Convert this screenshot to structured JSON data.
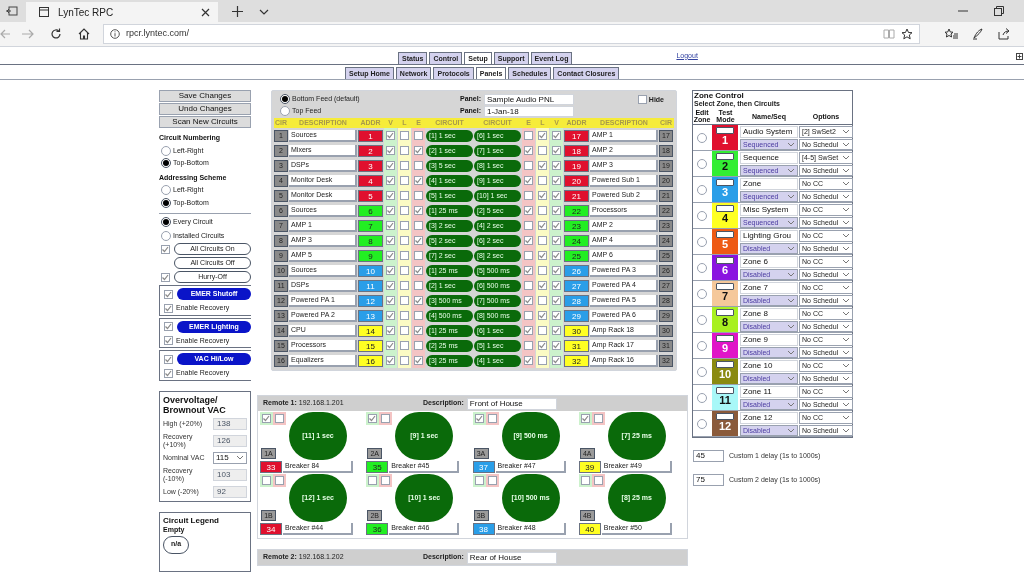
{
  "browser": {
    "tab_title": "LynTec RPC",
    "url": "rpcr.lyntec.com/"
  },
  "nav": {
    "tabs": [
      {
        "label": "Status",
        "selected": false
      },
      {
        "label": "Control",
        "selected": false
      },
      {
        "label": "Setup",
        "selected": true
      },
      {
        "label": "Support",
        "selected": false
      },
      {
        "label": "Event Log",
        "selected": false
      }
    ],
    "logout": "Logout",
    "subtabs": [
      {
        "label": "Setup Home",
        "selected": false
      },
      {
        "label": "Network",
        "selected": false
      },
      {
        "label": "Protocols",
        "selected": false
      },
      {
        "label": "Panels",
        "selected": true
      },
      {
        "label": "Schedules",
        "selected": false
      },
      {
        "label": "Contact Closures",
        "selected": false
      }
    ]
  },
  "sidebar": {
    "buttons": [
      "Save Changes",
      "Undo Changes",
      "Scan New Circuits"
    ],
    "groups": [
      {
        "title": "Circuit Numbering",
        "options": [
          {
            "label": "Left-Right",
            "selected": false
          },
          {
            "label": "Top-Bottom",
            "selected": true
          }
        ]
      },
      {
        "title": "Addressing Scheme",
        "options": [
          {
            "label": "Left-Right",
            "selected": false
          },
          {
            "label": "Top-Bottom",
            "selected": true
          }
        ]
      }
    ],
    "filter": [
      {
        "label": "Every Circuit",
        "selected": true
      },
      {
        "label": "Installed Circuits",
        "selected": false
      }
    ],
    "actions": [
      {
        "kind": "outline",
        "label": "All Circuits On",
        "checked": true
      },
      {
        "kind": "outline",
        "label": "All Circuits Off"
      },
      {
        "kind": "outline",
        "label": "Hurry-Off",
        "checked": true
      },
      {
        "kind": "emergency",
        "label": "EMER Shutoff",
        "checked": true,
        "recovery": {
          "label": "Enable Recovery",
          "checked": true
        }
      },
      {
        "kind": "emergency",
        "label": "EMER Lighting",
        "checked": true,
        "recovery": {
          "label": "Enable Recovery",
          "checked": true
        }
      },
      {
        "kind": "emergency",
        "label": "VAC Hi/Low",
        "checked": true,
        "recovery": {
          "label": "Enable Recovery",
          "checked": true
        }
      }
    ],
    "voltage": {
      "title": "Overvoltage/ Brownout VAC",
      "rows": [
        {
          "kind": "readonly",
          "label": "High (+20%)",
          "value": "138"
        },
        {
          "kind": "readonly",
          "label": "Recovery (+10%)",
          "value": "126"
        },
        {
          "kind": "select",
          "label": "Nominal VAC",
          "value": "115"
        },
        {
          "kind": "readonly",
          "label": "Recovery (-10%)",
          "value": "103"
        },
        {
          "kind": "readonly",
          "label": "Low (-20%)",
          "value": "92"
        }
      ]
    },
    "legend": {
      "title": "Circuit Legend",
      "subtitle": "Empty",
      "sample": "n/a"
    }
  },
  "panel": {
    "feeds": [
      {
        "label": "Bottom Feed (default)",
        "selected": true
      },
      {
        "label": "Top Feed",
        "selected": false
      }
    ],
    "fields": [
      {
        "label": "Panel:",
        "value": "Sample Audio PNL"
      },
      {
        "label": "Panel:",
        "value": "1-Jan-18"
      }
    ],
    "hide": {
      "label": "Hide",
      "checked": false
    },
    "columns_left": [
      "CIR",
      "DESCRIPTION",
      "ADDR",
      "V",
      "L",
      "E",
      "CIRCUIT"
    ],
    "columns_right": [
      "CIRCUIT",
      "E",
      "L",
      "V",
      "ADDR",
      "DESCRIPTION",
      "CIR"
    ],
    "rows": [
      {
        "left": {
          "cir": "1",
          "description": "Sources",
          "addr": "1",
          "color": "#e0102e",
          "v": true,
          "l": false,
          "e": false,
          "circuit": "[1] 1 sec"
        },
        "right": {
          "cir": "17",
          "description": "AMP 1",
          "addr": "17",
          "color": "#e0102e",
          "v": true,
          "l": true,
          "e": false,
          "circuit": "[6] 1 sec"
        }
      },
      {
        "left": {
          "cir": "2",
          "description": "Mixers",
          "addr": "2",
          "color": "#e0102e",
          "v": true,
          "l": false,
          "e": true,
          "circuit": "[2] 1 sec"
        },
        "right": {
          "cir": "18",
          "description": "AMP 2",
          "addr": "18",
          "color": "#e0102e",
          "v": true,
          "l": false,
          "e": true,
          "circuit": "[7] 1 sec"
        }
      },
      {
        "left": {
          "cir": "3",
          "description": "DSPs",
          "addr": "3",
          "color": "#e0102e",
          "v": true,
          "l": false,
          "e": false,
          "circuit": "[3] 5 sec"
        },
        "right": {
          "cir": "19",
          "description": "AMP 3",
          "addr": "19",
          "color": "#e0102e",
          "v": true,
          "l": true,
          "e": false,
          "circuit": "[8] 1 sec"
        }
      },
      {
        "left": {
          "cir": "4",
          "description": "Monitor Desk",
          "addr": "4",
          "color": "#e0102e",
          "v": true,
          "l": false,
          "e": true,
          "circuit": "[4] 1 sec"
        },
        "right": {
          "cir": "20",
          "description": "Powered Sub 1",
          "addr": "20",
          "color": "#e0102e",
          "v": true,
          "l": false,
          "e": true,
          "circuit": "[9] 1 sec"
        }
      },
      {
        "left": {
          "cir": "5",
          "description": "Monitor Desk",
          "addr": "5",
          "color": "#e0102e",
          "v": true,
          "l": false,
          "e": false,
          "circuit": "[5] 1 sec"
        },
        "right": {
          "cir": "21",
          "description": "Powered Sub 2",
          "addr": "21",
          "color": "#e0102e",
          "v": true,
          "l": true,
          "e": false,
          "circuit": "[10] 1 sec"
        }
      },
      {
        "left": {
          "cir": "6",
          "description": "Sources",
          "addr": "6",
          "color": "#22ee22",
          "v": true,
          "l": false,
          "e": true,
          "circuit": "[1] 25 ms"
        },
        "right": {
          "cir": "22",
          "description": "Processors",
          "addr": "22",
          "color": "#22ee22",
          "v": true,
          "l": false,
          "e": true,
          "circuit": "[2] 5 sec"
        }
      },
      {
        "left": {
          "cir": "7",
          "description": "AMP 1",
          "addr": "7",
          "color": "#22ee22",
          "v": true,
          "l": false,
          "e": false,
          "circuit": "[3] 2 sec"
        },
        "right": {
          "cir": "23",
          "description": "AMP 2",
          "addr": "23",
          "color": "#22ee22",
          "v": true,
          "l": true,
          "e": false,
          "circuit": "[4] 2 sec"
        }
      },
      {
        "left": {
          "cir": "8",
          "description": "AMP 3",
          "addr": "8",
          "color": "#22ee22",
          "v": true,
          "l": false,
          "e": true,
          "circuit": "[5] 2 sec"
        },
        "right": {
          "cir": "24",
          "description": "AMP 4",
          "addr": "24",
          "color": "#22ee22",
          "v": true,
          "l": false,
          "e": true,
          "circuit": "[6] 2 sec"
        }
      },
      {
        "left": {
          "cir": "9",
          "description": "AMP 5",
          "addr": "9",
          "color": "#22ee22",
          "v": true,
          "l": false,
          "e": false,
          "circuit": "[7] 2 sec"
        },
        "right": {
          "cir": "25",
          "description": "AMP 6",
          "addr": "25",
          "color": "#22ee22",
          "v": true,
          "l": true,
          "e": false,
          "circuit": "[8] 2 sec"
        }
      },
      {
        "left": {
          "cir": "10",
          "description": "Sources",
          "addr": "10",
          "color": "#2a9ee8",
          "v": true,
          "l": false,
          "e": true,
          "circuit": "[1] 25 ms"
        },
        "right": {
          "cir": "26",
          "description": "Powered PA 3",
          "addr": "26",
          "color": "#2a9ee8",
          "v": true,
          "l": false,
          "e": true,
          "circuit": "[5] 500 ms"
        }
      },
      {
        "left": {
          "cir": "11",
          "description": "DSPs",
          "addr": "11",
          "color": "#2a9ee8",
          "v": true,
          "l": false,
          "e": false,
          "circuit": "[2] 1 sec"
        },
        "right": {
          "cir": "27",
          "description": "Powered PA 4",
          "addr": "27",
          "color": "#2a9ee8",
          "v": true,
          "l": true,
          "e": false,
          "circuit": "[6] 500 ms"
        }
      },
      {
        "left": {
          "cir": "12",
          "description": "Powered PA 1",
          "addr": "12",
          "color": "#2a9ee8",
          "v": true,
          "l": false,
          "e": true,
          "circuit": "[3] 500 ms"
        },
        "right": {
          "cir": "28",
          "description": "Powered PA 5",
          "addr": "28",
          "color": "#2a9ee8",
          "v": true,
          "l": false,
          "e": true,
          "circuit": "[7] 500 ms"
        }
      },
      {
        "left": {
          "cir": "13",
          "description": "Powered PA 2",
          "addr": "13",
          "color": "#2a9ee8",
          "v": true,
          "l": false,
          "e": false,
          "circuit": "[4] 500 ms"
        },
        "right": {
          "cir": "29",
          "description": "Powered PA 6",
          "addr": "29",
          "color": "#2a9ee8",
          "v": true,
          "l": true,
          "e": false,
          "circuit": "[8] 500 ms"
        }
      },
      {
        "left": {
          "cir": "14",
          "description": "CPU",
          "addr": "14",
          "color": "#ffff22",
          "v": true,
          "l": false,
          "e": true,
          "circuit": "[1] 25 ms"
        },
        "right": {
          "cir": "30",
          "description": "Amp Rack 18",
          "addr": "30",
          "color": "#ffff22",
          "v": true,
          "l": false,
          "e": true,
          "circuit": "[6] 1 sec"
        }
      },
      {
        "left": {
          "cir": "15",
          "description": "Processors",
          "addr": "15",
          "color": "#ffff22",
          "v": true,
          "l": false,
          "e": false,
          "circuit": "[2] 25 ms"
        },
        "right": {
          "cir": "31",
          "description": "Amp Rack 17",
          "addr": "31",
          "color": "#ffff22",
          "v": true,
          "l": true,
          "e": false,
          "circuit": "[5] 1 sec"
        }
      },
      {
        "left": {
          "cir": "16",
          "description": "Equalizers",
          "addr": "16",
          "color": "#ffff22",
          "v": true,
          "l": false,
          "e": true,
          "circuit": "[3] 25 ms"
        },
        "right": {
          "cir": "32",
          "description": "Amp Rack 16",
          "addr": "32",
          "color": "#ffff22",
          "v": true,
          "l": false,
          "e": true,
          "circuit": "[4] 1 sec"
        }
      }
    ]
  },
  "remotes": [
    {
      "label": "Remote 1:",
      "ip": "192.168.1.201",
      "description_label": "Description:",
      "description": "Front of House",
      "breakers": [
        {
          "v": true,
          "e": false,
          "circuit": "[11] 1 sec",
          "position": "1A",
          "addr": "33",
          "color": "#e0102e",
          "name": "Breaker 84"
        },
        {
          "v": true,
          "e": false,
          "circuit": "[9] 1 sec",
          "position": "2A",
          "addr": "35",
          "color": "#22ee22",
          "name": "Breaker #45"
        },
        {
          "v": true,
          "e": false,
          "circuit": "[9] 500 ms",
          "position": "3A",
          "addr": "37",
          "color": "#2a9ee8",
          "name": "Breaker #47"
        },
        {
          "v": true,
          "e": false,
          "circuit": "[7] 25 ms",
          "position": "4A",
          "addr": "39",
          "color": "#ffff22",
          "name": "Breaker #49"
        },
        {
          "v": false,
          "e": false,
          "circuit": "[12] 1 sec",
          "position": "1B",
          "addr": "34",
          "color": "#e0102e",
          "name": "Breaker #44"
        },
        {
          "v": false,
          "e": false,
          "circuit": "[10] 1 sec",
          "position": "2B",
          "addr": "36",
          "color": "#22ee22",
          "name": "Breaker #46"
        },
        {
          "v": false,
          "e": false,
          "circuit": "[10] 500 ms",
          "position": "3B",
          "addr": "38",
          "color": "#2a9ee8",
          "name": "Breaker #48"
        },
        {
          "v": false,
          "e": false,
          "circuit": "[8] 25 ms",
          "position": "4B",
          "addr": "40",
          "color": "#ffff22",
          "name": "Breaker #50"
        }
      ]
    },
    {
      "label": "Remote 2:",
      "ip": "192.168.1.202",
      "description_label": "Description:",
      "description": "Rear of House"
    }
  ],
  "zone_control": {
    "title": "Zone Control",
    "subtitle": "Select Zone, then Circuits",
    "columns": [
      "Edit Zone",
      "Test Mode",
      "Name/Seq",
      "Options"
    ],
    "zones": [
      {
        "number": "1",
        "color": "#e0102e",
        "name": "Audio System",
        "mode": "Sequenced",
        "cc": "[2] SwSet2",
        "schedule": "No Schedul",
        "selected": false
      },
      {
        "number": "2",
        "color": "#33ee33",
        "name": "Sequence",
        "mode": "Sequenced",
        "cc": "[4-5] SwSet",
        "schedule": "No Schedul",
        "selected": false
      },
      {
        "number": "3",
        "color": "#2a9ee8",
        "name": "Zone",
        "mode": "Sequenced",
        "cc": "No CC",
        "schedule": "No Schedul",
        "selected": false
      },
      {
        "number": "4",
        "color": "#ffff22",
        "name": "Misc System",
        "mode": "Sequenced",
        "cc": "No CC",
        "schedule": "No Schedul",
        "selected": false
      },
      {
        "number": "5",
        "color": "#ee5a14",
        "name": "Lighting Grou",
        "mode": "Disabled",
        "cc": "No CC",
        "schedule": "No Schedul",
        "selected": false
      },
      {
        "number": "6",
        "color": "#8a14e0",
        "name": "Zone 6",
        "mode": "Disabled",
        "cc": "No CC",
        "schedule": "No Schedul",
        "selected": false
      },
      {
        "number": "7",
        "color": "#f5c89a",
        "name": "Zone 7",
        "mode": "Disabled",
        "cc": "No CC",
        "schedule": "No Schedul",
        "selected": false
      },
      {
        "number": "8",
        "color": "#a8f020",
        "name": "Zone 8",
        "mode": "Disabled",
        "cc": "No CC",
        "schedule": "No Schedul",
        "selected": false
      },
      {
        "number": "9",
        "color": "#e014c8",
        "name": "Zone 9",
        "mode": "Disabled",
        "cc": "No CC",
        "schedule": "No Schedul",
        "selected": false
      },
      {
        "number": "10",
        "color": "#8a8a10",
        "name": "Zone 10",
        "mode": "Disabled",
        "cc": "No CC",
        "schedule": "No Schedul",
        "selected": false
      },
      {
        "number": "11",
        "color": "#a8f8f8",
        "name": "Zone 11",
        "mode": "Disabled",
        "cc": "No CC",
        "schedule": "No Schedul",
        "selected": false
      },
      {
        "number": "12",
        "color": "#8a5a3a",
        "name": "Zone 12",
        "mode": "Disabled",
        "cc": "No CC",
        "schedule": "No Schedul",
        "selected": false
      }
    ],
    "delays": [
      {
        "value": "45",
        "label": "Custom 1 delay (1s to 1000s)"
      },
      {
        "value": "75",
        "label": "Custom 2 delay (1s to 1000s)"
      }
    ]
  }
}
